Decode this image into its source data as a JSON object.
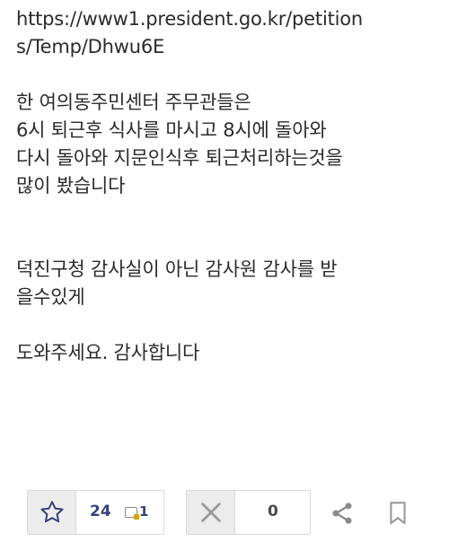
{
  "post": {
    "url_line_1": "https://www1.president.go.kr/petition",
    "url_line_2": "s/Temp/Dhwu6E",
    "paragraph_1": [
      "한 여의동주민센터 주무관들은",
      "6시 퇴근후 식사를 마시고 8시에 돌아와",
      "다시 돌아와 지문인식후 퇴근처리하는것을",
      "많이 봤습니다"
    ],
    "paragraph_2": [
      "덕진구청 감사실이 아닌 감사원 감사를 받",
      "을수있게"
    ],
    "paragraph_3": "도와주세요. 감사합니다"
  },
  "actions": {
    "upvote_count": "24",
    "badge_count": "1",
    "downvote_count": "0",
    "upvote_icon": "star-icon",
    "downvote_icon": "x-icon",
    "share_icon": "share-icon",
    "bookmark_icon": "bookmark-icon",
    "accent_color": "#3a3f7a",
    "badge_color": "#d8a100"
  }
}
